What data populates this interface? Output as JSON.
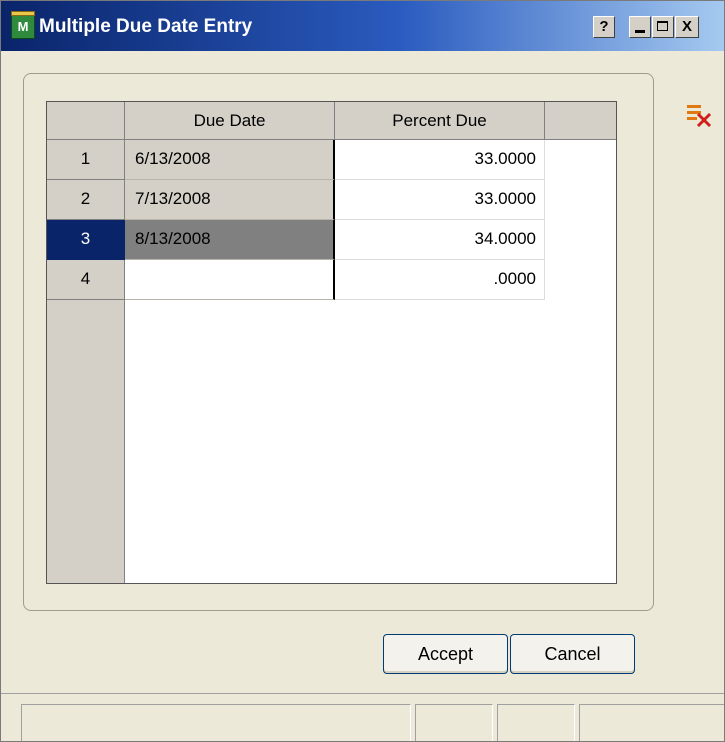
{
  "window": {
    "title": "Multiple Due Date Entry",
    "app_icon_label": "M",
    "controls": {
      "help": "?",
      "minimize": "_",
      "maximize": "□",
      "close": "X"
    }
  },
  "grid": {
    "columns": [
      "Due Date",
      "Percent Due"
    ],
    "rows": [
      {
        "num": "1",
        "due_date": "6/13/2008",
        "percent_due": "33.0000"
      },
      {
        "num": "2",
        "due_date": "7/13/2008",
        "percent_due": "33.0000"
      },
      {
        "num": "3",
        "due_date": "8/13/2008",
        "percent_due": "34.0000"
      },
      {
        "num": "4",
        "due_date": "",
        "percent_due": ".0000"
      }
    ],
    "selected_row": "3"
  },
  "toolbar": {
    "delete_icon": "delete-row-icon"
  },
  "buttons": {
    "accept": "Accept",
    "cancel": "Cancel"
  },
  "colors": {
    "selection": "#0a246a",
    "selected_cell": "#808080",
    "titlebar": "#0a246a",
    "face": "#ece9d8"
  }
}
